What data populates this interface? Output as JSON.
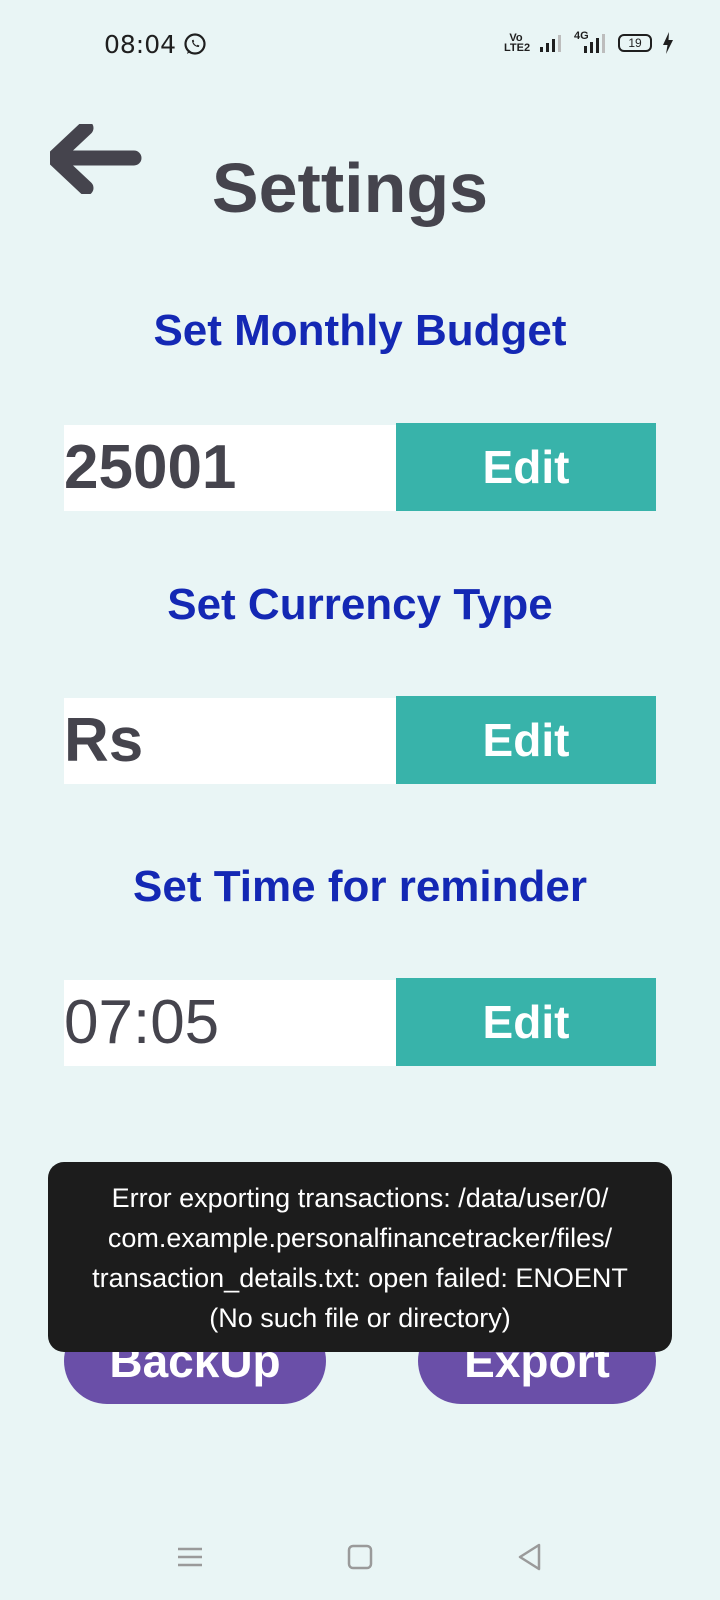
{
  "status_bar": {
    "time": "08:04",
    "volte_label": "Vo LTE2",
    "network_label": "4G",
    "battery_level": "19",
    "icons": [
      "whatsapp-icon",
      "signal-icon",
      "4g-signal-icon",
      "battery-icon",
      "charging-icon"
    ]
  },
  "header": {
    "title": "Settings",
    "back_icon": "arrow-left-icon"
  },
  "budget": {
    "label": "Set Monthly Budget",
    "value": "25001",
    "button": "Edit"
  },
  "currency": {
    "label": "Set Currency Type",
    "value": "Rs",
    "button": "Edit"
  },
  "reminder": {
    "label": "Set Time for reminder",
    "value": "07:05",
    "button": "Edit"
  },
  "actions": {
    "backup": "BackUp",
    "export": "Export"
  },
  "toast": {
    "line1": "Error exporting transactions: /data/user/0/",
    "line2": "com.example.personalfinancetracker/files/",
    "line3": "transaction_details.txt: open failed: ENOENT",
    "line4": "(No such file or directory)"
  },
  "nav_bar": {
    "icons": [
      "menu-icon",
      "home-icon",
      "back-icon"
    ]
  },
  "colors": {
    "background": "#e9f5f5",
    "title": "#45444d",
    "section_label": "#1428b4",
    "edit_button": "#38b3aa",
    "pill_button": "#6a4fa8",
    "toast": "#1c1c1c"
  }
}
